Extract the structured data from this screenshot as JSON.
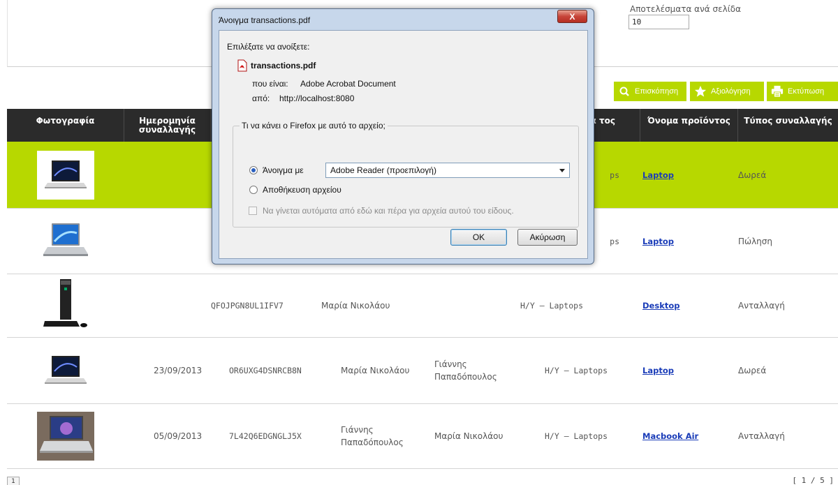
{
  "filters": {
    "results_per_page_label": "Αποτελέσματα ανά σελίδα",
    "results_per_page_value": "10"
  },
  "actions": {
    "preview": "Επισκόπηση",
    "rate": "Αξιολόγηση",
    "print": "Εκτύπωση"
  },
  "table": {
    "headers": [
      "Φωτογραφία",
      "Ημερομηνία συναλλαγής",
      "",
      "",
      "",
      "ορία τος",
      "Όνομα προϊόντος",
      "Τύπος συναλλαγής"
    ],
    "rows": [
      {
        "date": "",
        "code": "",
        "from": "",
        "to": "",
        "category": "ps",
        "product": "Laptop",
        "type": "Δωρεά",
        "image": "laptop-vaio-icon"
      },
      {
        "date": "",
        "code": "",
        "from": "",
        "to": "",
        "category": "ps",
        "product": "Laptop",
        "type": "Πώληση",
        "image": "laptop-silver-icon"
      },
      {
        "date": "",
        "code": "QFOJPGN8UL1IFV7",
        "from": "Μαρία Νικολάου",
        "to": "",
        "category": "H/Y – Laptops",
        "product": "Desktop",
        "type": "Ανταλλαγή",
        "image": "desktop-pc-icon"
      },
      {
        "date": "23/09/2013",
        "code": "OR6UXG4DSNRCB8N",
        "from": "Μαρία Νικολάου",
        "to": "Γιάννης Παπαδόπουλος",
        "category": "H/Y – Laptops",
        "product": "Laptop",
        "type": "Δωρεά",
        "image": "laptop-vaio-icon"
      },
      {
        "date": "05/09/2013",
        "code": "7L42Q6EDGNGLJ5X",
        "from": "Γιάννης Παπαδόπουλος",
        "to": "Μαρία Νικολάου",
        "category": "H/Y – Laptops",
        "product": "Macbook Air",
        "type": "Ανταλλαγή",
        "image": "macbook-air-icon"
      }
    ]
  },
  "pagination": {
    "current_page": "1",
    "page_count": "[ 1 / 5 ]"
  },
  "dialog": {
    "title": "Άνοιγμα transactions.pdf",
    "close_label": "X",
    "prompt": "Επιλέξατε να ανοίξετε:",
    "filename": "transactions.pdf",
    "type_label": "που είναι:",
    "type_value": "Adobe Acrobat Document",
    "from_label": "από:",
    "from_value": "http://localhost:8080",
    "question": "Τι να κάνει ο Firefox με αυτό το αρχείο;",
    "open_with_label": "Άνοιγμα με",
    "open_with_value": "Adobe Reader (προεπιλογή)",
    "save_label": "Αποθήκευση αρχείου",
    "auto_label": "Να γίνεται αυτόματα από εδώ και πέρα για αρχεία αυτού του είδους.",
    "ok_label": "OK",
    "cancel_label": "Ακύρωση"
  },
  "colors": {
    "accent": "#b7d800",
    "header_bg": "#2b2b2b",
    "link": "#1a3cb8"
  }
}
